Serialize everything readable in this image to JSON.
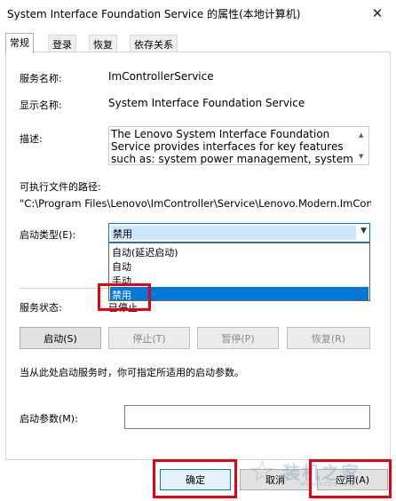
{
  "window": {
    "title": "System Interface Foundation Service 的属性(本地计算机)",
    "close_glyph": "✕"
  },
  "tabs": [
    {
      "label": "常规",
      "active": true
    },
    {
      "label": "登录"
    },
    {
      "label": "恢复"
    },
    {
      "label": "依存关系"
    }
  ],
  "general": {
    "service_name_label": "服务名称:",
    "service_name": "ImControllerService",
    "display_name_label": "显示名称:",
    "display_name": "System Interface Foundation Service",
    "description_label": "描述:",
    "description": "The Lenovo System Interface Foundation Service provides interfaces for key features such as: system power management, system optimization",
    "path_label": "可执行文件的路径:",
    "path": "\"C:\\Program Files\\Lenovo\\ImController\\Service\\Lenovo.Modern.ImController.exe\"",
    "startup_type_label": "启动类型(E):",
    "startup_type_value": "禁用",
    "startup_options": [
      "自动(延迟启动)",
      "自动",
      "手动",
      "禁用"
    ],
    "startup_selected_index": 3,
    "status_label": "服务状态:",
    "status_value": "已停止",
    "buttons": {
      "start": "启动(S)",
      "stop": "停止(T)",
      "pause": "暂停(P)",
      "resume": "恢复(R)"
    },
    "hint": "当从此处启动服务时，你可指定所适用的启动参数。",
    "params_label": "启动参数(M):",
    "params_value": ""
  },
  "footer": {
    "ok": "确定",
    "cancel": "取消",
    "apply": "应用(A)"
  },
  "watermark": {
    "text": "装机之家",
    "url": "www.lotpc.com"
  },
  "colors": {
    "highlight": "#e60012",
    "selection": "#0078d7"
  }
}
